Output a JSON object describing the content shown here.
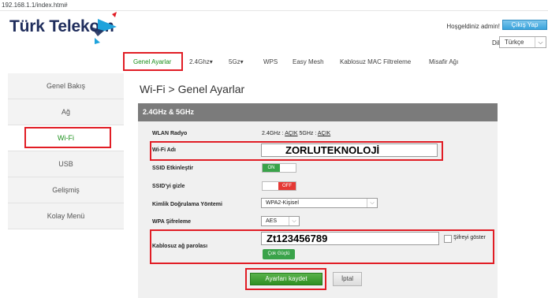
{
  "browser": {
    "address": "192.168.1.1/index.htm#"
  },
  "header": {
    "logo_text": "Türk Telekom",
    "welcome": "Hoşgeldiniz admin!",
    "logout": "Çıkış Yap",
    "lang_label": "Dil",
    "lang_value": "Türkçe",
    "colors": {
      "logo_blue": "#1f2d5c",
      "logo_cyan": "#1fa3dc",
      "logo_red": "#e11d25"
    }
  },
  "topnav": {
    "tabs": [
      {
        "label": "Genel Ayarlar"
      },
      {
        "label": "2.4Ghz"
      },
      {
        "label": "5Gz"
      },
      {
        "label": "WPS"
      },
      {
        "label": "Easy Mesh"
      },
      {
        "label": "Kablosuz MAC Filtreleme"
      },
      {
        "label": "Misafir Ağı"
      }
    ]
  },
  "sidebar": {
    "items": [
      {
        "label": "Genel Bakış"
      },
      {
        "label": "Ağ"
      },
      {
        "label": "Wi-Fi"
      },
      {
        "label": "USB"
      },
      {
        "label": "Gelişmiş"
      },
      {
        "label": "Kolay Menü"
      }
    ]
  },
  "main": {
    "title": "Wi-Fi > Genel Ayarlar",
    "section": "2.4GHz & 5GHz",
    "wlan_label": "WLAN Radyo",
    "wlan_24": "2.4GHz :",
    "wlan_24_state": "AÇIK",
    "wlan_5": "5GHz :",
    "wlan_5_state": "AÇIK",
    "ssid_label": "Wi-Fi Adı",
    "ssid_value": "ZORLUTEKNOLOJİ",
    "ssid_enable_label": "SSID Etkinleştir",
    "ssid_enable_state": "ON",
    "ssid_hide_label": "SSID'yi gizle",
    "ssid_hide_state": "OFF",
    "auth_label": "Kimlik Doğrulama Yöntemi",
    "auth_value": "WPA2-Kişisel",
    "enc_label": "WPA Şifreleme",
    "enc_value": "AES",
    "pass_label": "Kablosuz ağ parolası",
    "pass_value": "Zt123456789",
    "show_pass_label": "Şifreyi göster",
    "strength": "Çok Güçlü",
    "save": "Ayarları kaydet",
    "cancel": "İptal"
  }
}
